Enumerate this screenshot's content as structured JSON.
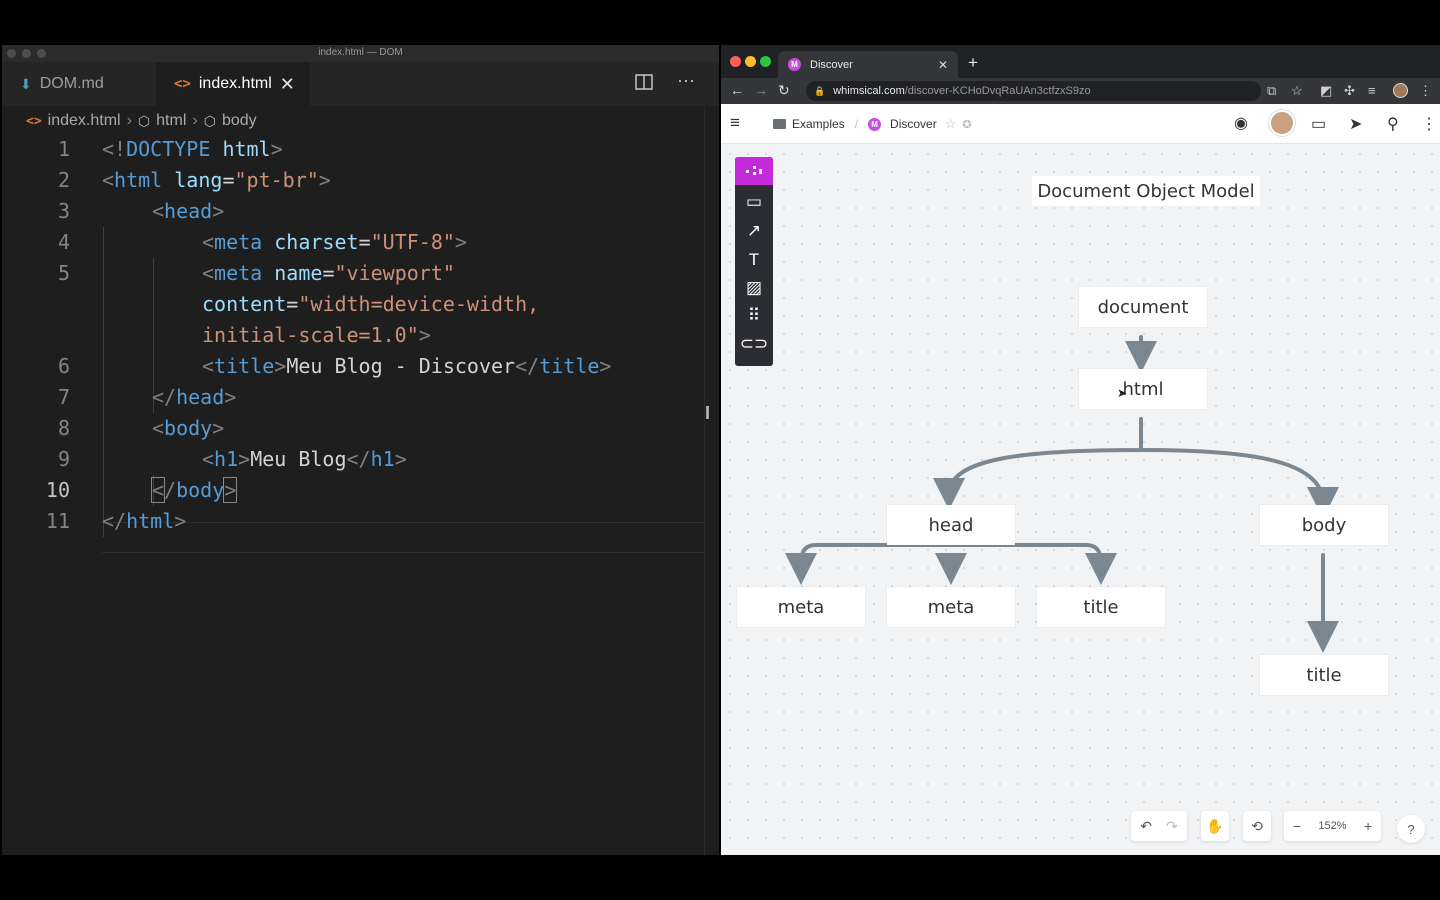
{
  "editor": {
    "window_title": "index.html — DOM",
    "tabs": [
      {
        "label": "DOM.md",
        "icon": "markdown-icon"
      },
      {
        "label": "index.html",
        "icon": "html-icon",
        "active": true
      }
    ],
    "breadcrumbs": [
      "index.html",
      "html",
      "body"
    ],
    "current_line": 10,
    "lines": [
      {
        "n": "1"
      },
      {
        "n": "2"
      },
      {
        "n": "3"
      },
      {
        "n": "4"
      },
      {
        "n": "5"
      },
      {
        "n": ""
      },
      {
        "n": ""
      },
      {
        "n": "6"
      },
      {
        "n": "7"
      },
      {
        "n": "8"
      },
      {
        "n": "9"
      },
      {
        "n": "10"
      },
      {
        "n": "11"
      }
    ],
    "code": {
      "doctype": "<!DOCTYPE html>",
      "html_lang": "pt-br",
      "charset": "UTF-8",
      "meta_name": "viewport",
      "content_1": "width=device-width,",
      "content_2": "initial-scale=1.0",
      "title_text": "Meu Blog - Discover",
      "h1_text": "Meu Blog"
    }
  },
  "browser": {
    "tab_title": "Discover",
    "url_host": "whimsical.com",
    "url_path": "/discover-KCHoDvqRaUAn3ctfzxS9zo",
    "breadcrumb_folder": "Examples",
    "breadcrumb_doc": "Discover",
    "zoom": "152%",
    "help": "?"
  },
  "diagram": {
    "title": "Document Object Model",
    "nodes": {
      "document": "document",
      "html": "html",
      "head": "head",
      "body": "body",
      "meta1": "meta",
      "meta2": "meta",
      "title_head": "title",
      "title_body": "title"
    }
  },
  "colors": {
    "accent": "#c32bd9",
    "edge": "#7b8791",
    "editor_bg": "#1e1e1e"
  }
}
